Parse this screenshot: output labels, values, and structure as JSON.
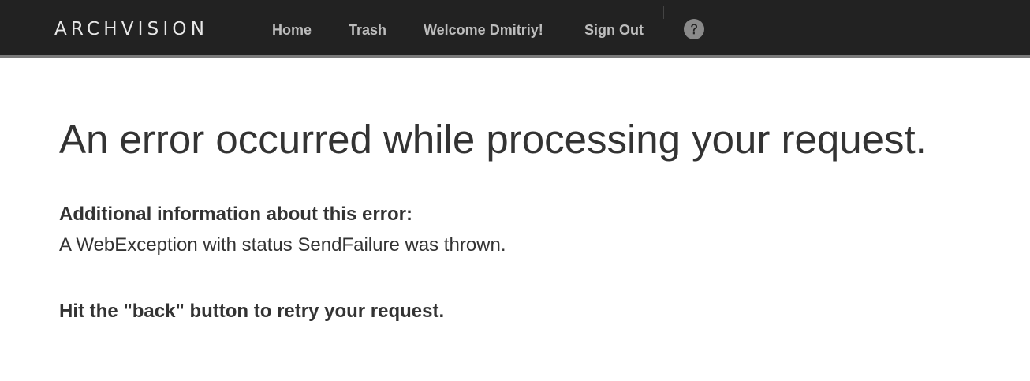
{
  "header": {
    "logo_text": "ARCHVISION",
    "nav": {
      "home": "Home",
      "trash": "Trash",
      "welcome": "Welcome Dmitriy!",
      "sign_out": "Sign Out"
    },
    "help_icon": "question-circle-icon",
    "colors": {
      "background": "#222222",
      "border": "#7a7a7a",
      "link": "#bdbdbd",
      "logo": "#e8e8e8"
    }
  },
  "main": {
    "title": "An error occurred while processing your request.",
    "additional_heading": "Additional information about this error:",
    "additional_text": "A WebException with status SendFailure was thrown.",
    "retry_text": "Hit the \"back\" button to retry your request."
  }
}
